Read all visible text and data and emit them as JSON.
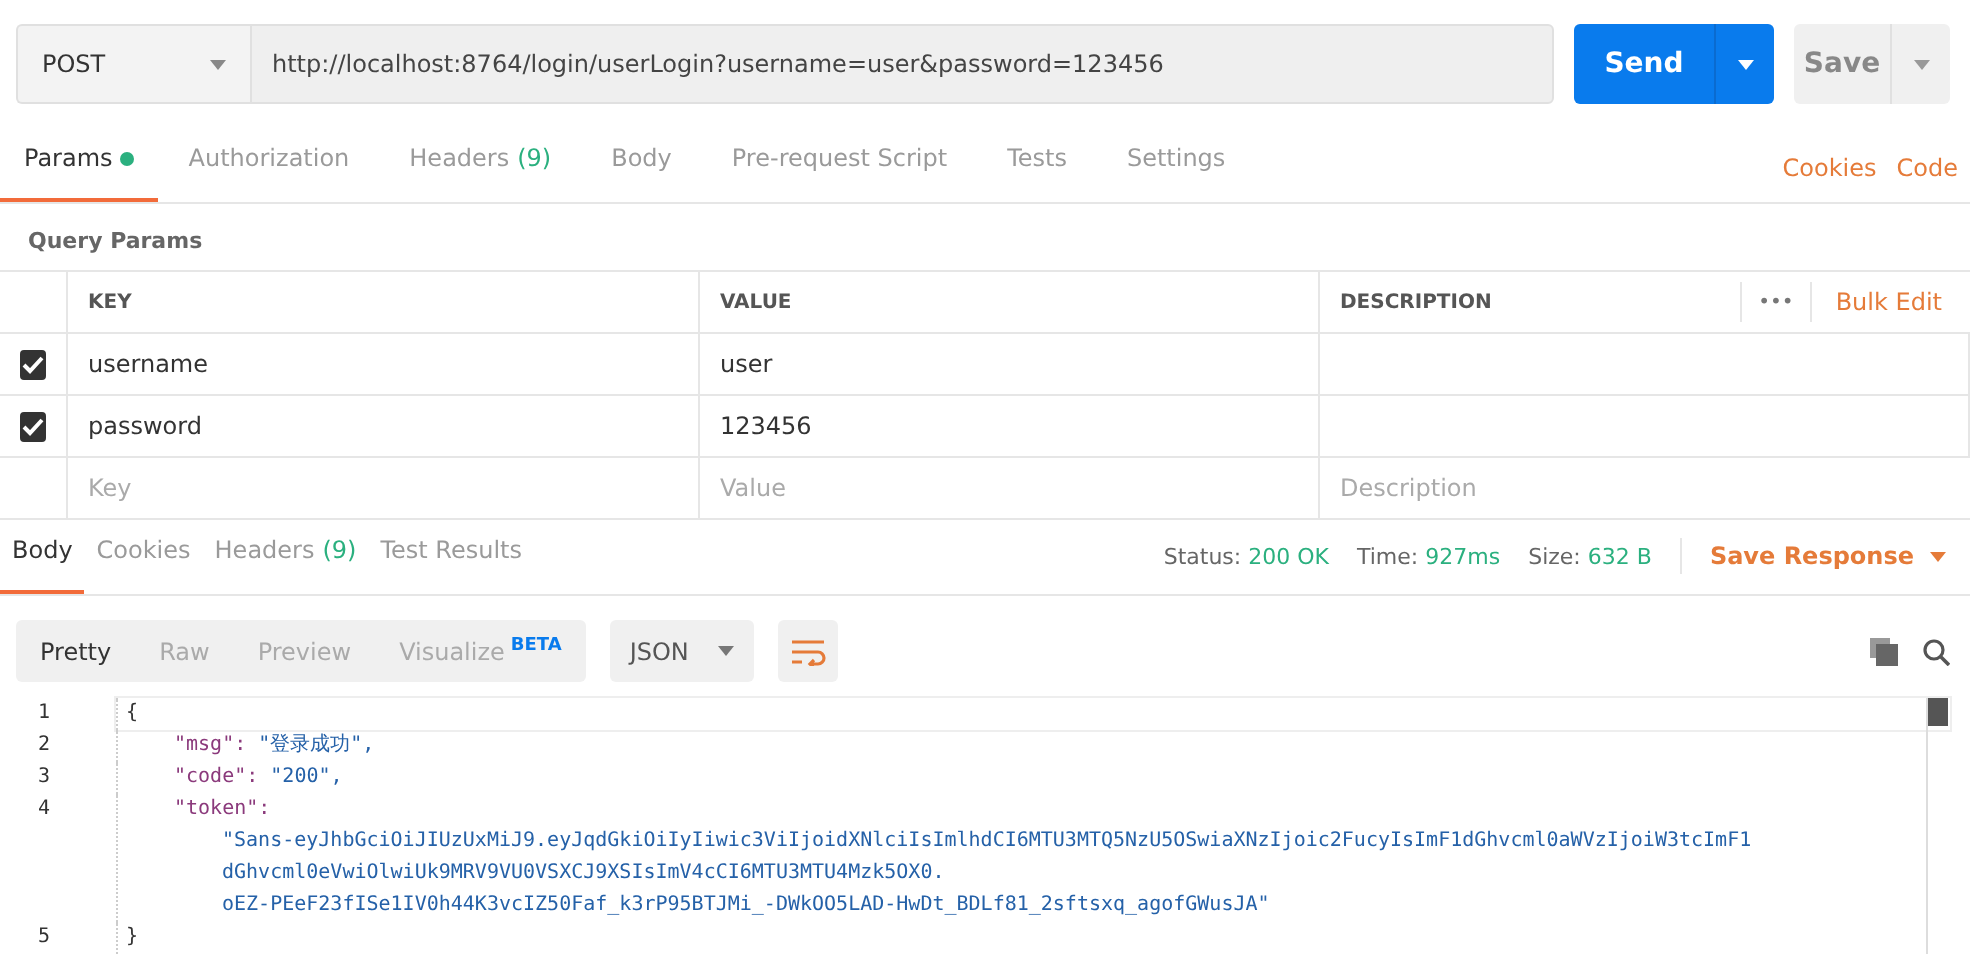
{
  "request": {
    "method": "POST",
    "url": "http://localhost:8764/login/userLogin?username=user&password=123456",
    "send_label": "Send",
    "save_label": "Save"
  },
  "request_tabs": [
    {
      "label": "Params",
      "selected": true,
      "dot": true
    },
    {
      "label": "Authorization",
      "selected": false
    },
    {
      "label": "Headers",
      "count": "(9)",
      "selected": false
    },
    {
      "label": "Body",
      "selected": false
    },
    {
      "label": "Pre-request Script",
      "selected": false
    },
    {
      "label": "Tests",
      "selected": false
    },
    {
      "label": "Settings",
      "selected": false
    }
  ],
  "request_links": [
    "Cookies",
    "Code"
  ],
  "query_params": {
    "title": "Query Params",
    "columns": [
      "KEY",
      "VALUE",
      "DESCRIPTION"
    ],
    "more": "•••",
    "bulk_edit": "Bulk Edit",
    "rows": [
      {
        "checked": true,
        "key": "username",
        "value": "user"
      },
      {
        "checked": true,
        "key": "password",
        "value": "123456"
      }
    ],
    "placeholders": [
      "Key",
      "Value",
      "Description"
    ]
  },
  "response_tabs": [
    {
      "label": "Body",
      "selected": true
    },
    {
      "label": "Cookies",
      "selected": false
    },
    {
      "label": "Headers",
      "count": "(9)",
      "selected": false
    },
    {
      "label": "Test Results",
      "selected": false
    }
  ],
  "status": [
    {
      "label": "Status:",
      "value": "200 OK"
    },
    {
      "label": "Time:",
      "value": "927ms"
    },
    {
      "label": "Size:",
      "value": "632 B"
    }
  ],
  "save_response": "Save Response",
  "view_modes": [
    {
      "label": "Pretty",
      "selected": true
    },
    {
      "label": "Raw",
      "selected": false
    },
    {
      "label": "Preview",
      "selected": false
    },
    {
      "label": "Visualize",
      "badge": "BETA",
      "selected": false
    }
  ],
  "format": "JSON",
  "code": [
    {
      "number": "1",
      "kind": "brace",
      "text": "{"
    },
    {
      "number": "2",
      "kind": "pair",
      "key": "\"msg\":",
      "value_lines": [
        "\"登录成功\","
      ]
    },
    {
      "number": "3",
      "kind": "pair",
      "key": "\"code\":",
      "value_lines": [
        "\"200\","
      ]
    },
    {
      "number": "4",
      "kind": "wrapped",
      "key": "\"token\":",
      "value_lines": [
        "\"Sans-eyJhbGciOiJIUzUxMiJ9.eyJqdGkiOiIyIiwic3ViIjoidXNlciIsImlhdCI6MTU3MTQ5NzU5OSwiaXNzIjoic2FucyIsImF1dGhvcml0aWVzIjoiW3tcImF1",
        "dGhvcml0eVwiOlwiUk9MRV9VU0VSXCJ9XSIsImV4cCI6MTU3MTU4Mzk5OX0.",
        "oEZ-PEeF23fISe1IV0h44K3vcIZ50Faf_k3rP95BTJMi_-DWkOO5LAD-HwDt_BDLf81_2sftsxq_agofGWusJA\""
      ]
    },
    {
      "number": "5",
      "kind": "brace",
      "text": "}"
    }
  ]
}
